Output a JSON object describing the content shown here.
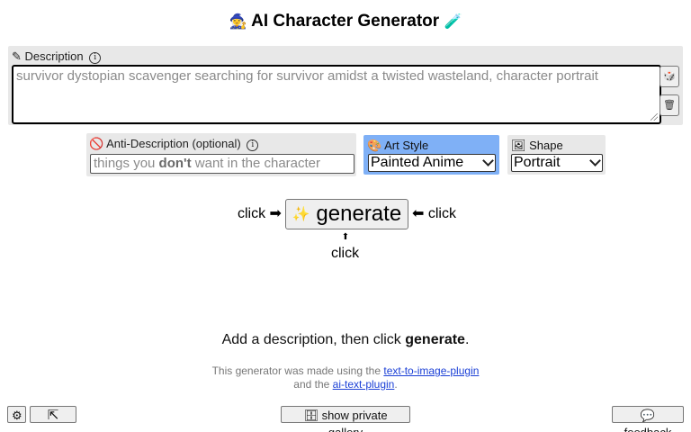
{
  "title": {
    "icon": "🧙‍♀",
    "text": "AI Character Generator",
    "suffix_icon": "🧪"
  },
  "description": {
    "label": "Description",
    "icon": "pencil-icon",
    "info_symbol": "i",
    "value": "survivor dystopian scavenger searching for survivor amidst a twisted wasteland, character portrait",
    "side_buttons": [
      "🎲",
      "🗑"
    ]
  },
  "anti_description": {
    "label": "Anti-Description (optional)",
    "icon": "no-icon",
    "info_symbol": "i",
    "placeholder_pre": "things you ",
    "placeholder_bold": "don't",
    "placeholder_post": " want in the character"
  },
  "art_style": {
    "label": "Art Style",
    "icon": "palette-icon",
    "selected": "Painted Anime",
    "highlight_color": "#7fb0f6"
  },
  "shape": {
    "label": "Shape",
    "icon": "frame-icon",
    "selected": "Portrait"
  },
  "generate": {
    "click_left": "click ➡",
    "button_sparkle": "✨",
    "button_label": "generate",
    "click_right": "⬅ click",
    "arrow_up": "⬆",
    "click_below": "click"
  },
  "hint": {
    "pre": "Add a description, then click ",
    "bold": "generate",
    "post": "."
  },
  "credits": {
    "line1_pre": "This generator was made using the ",
    "line1_link": "text-to-image-plugin",
    "line2_pre": "and the ",
    "line2_link": "ai-text-plugin",
    "line2_post": "."
  },
  "bottom": {
    "settings_icon": "⚙",
    "upleft_icon": "⇱",
    "gallery_icon": "🗄",
    "gallery_label": "show private gallery",
    "feedback_icon": "💬",
    "feedback_label": "feedback"
  }
}
